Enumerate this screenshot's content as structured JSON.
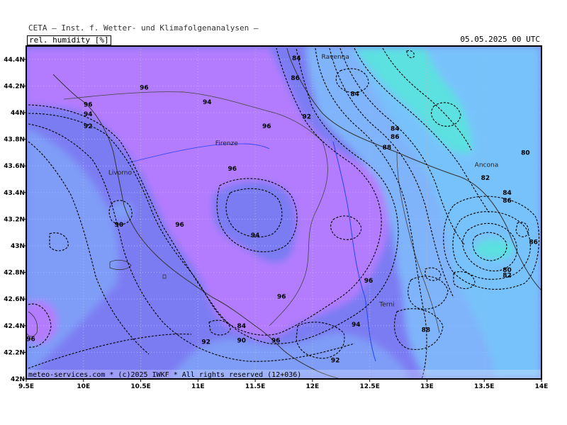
{
  "header": {
    "title": "CETA — Inst. f. Wetter- und Klimafolgenanalysen —",
    "field": "rel. humidity [%]",
    "datetime": "05.05.2025 00 UTC"
  },
  "footer": "meteo-services.com * (c)2025 IWKF * All rights reserved (12+036)",
  "axes": {
    "x_ticks": [
      "9.5E",
      "10E",
      "10.5E",
      "11E",
      "11.5E",
      "12E",
      "12.5E",
      "13E",
      "13.5E",
      "14E"
    ],
    "y_ticks": [
      "44.4N",
      "44.2N",
      "44N",
      "43.8N",
      "43.6N",
      "43.4N",
      "43.2N",
      "43N",
      "42.8N",
      "42.6N",
      "42.4N",
      "42.2N",
      "42N"
    ],
    "lon_range": [
      9.5,
      14.0
    ],
    "lat_range": [
      42.0,
      44.5
    ]
  },
  "cities": [
    {
      "name": "Ravenna",
      "lon": 12.2,
      "lat": 44.42
    },
    {
      "name": "Firenze",
      "lon": 11.25,
      "lat": 43.77
    },
    {
      "name": "Livorno",
      "lon": 10.32,
      "lat": 43.55
    },
    {
      "name": "Ancona",
      "lon": 13.52,
      "lat": 43.61
    },
    {
      "name": "Terni",
      "lon": 12.65,
      "lat": 42.56
    }
  ],
  "contour_labels": [
    {
      "text": "84",
      "lon": 11.86,
      "lat": 44.41
    },
    {
      "text": "86",
      "lon": 11.85,
      "lat": 44.26
    },
    {
      "text": "96",
      "lon": 10.53,
      "lat": 44.19
    },
    {
      "text": "84",
      "lon": 12.37,
      "lat": 44.14
    },
    {
      "text": "94",
      "lon": 11.08,
      "lat": 44.08
    },
    {
      "text": "96",
      "lon": 10.04,
      "lat": 44.06
    },
    {
      "text": "94",
      "lon": 10.04,
      "lat": 43.99
    },
    {
      "text": "92",
      "lon": 11.95,
      "lat": 43.97
    },
    {
      "text": "92",
      "lon": 10.04,
      "lat": 43.9
    },
    {
      "text": "96",
      "lon": 11.6,
      "lat": 43.9
    },
    {
      "text": "84",
      "lon": 12.72,
      "lat": 43.88
    },
    {
      "text": "86",
      "lon": 12.72,
      "lat": 43.82
    },
    {
      "text": "88",
      "lon": 12.65,
      "lat": 43.74
    },
    {
      "text": "80",
      "lon": 13.86,
      "lat": 43.7
    },
    {
      "text": "96",
      "lon": 11.3,
      "lat": 43.58
    },
    {
      "text": "82",
      "lon": 13.51,
      "lat": 43.51
    },
    {
      "text": "84",
      "lon": 13.7,
      "lat": 43.4
    },
    {
      "text": "86",
      "lon": 13.7,
      "lat": 43.34
    },
    {
      "text": "90",
      "lon": 10.31,
      "lat": 43.16
    },
    {
      "text": "96",
      "lon": 10.84,
      "lat": 43.16
    },
    {
      "text": "94",
      "lon": 11.5,
      "lat": 43.08
    },
    {
      "text": "86",
      "lon": 13.93,
      "lat": 43.03
    },
    {
      "text": "80",
      "lon": 13.7,
      "lat": 42.82
    },
    {
      "text": "82",
      "lon": 13.7,
      "lat": 42.78
    },
    {
      "text": "96",
      "lon": 12.49,
      "lat": 42.74
    },
    {
      "text": "96",
      "lon": 11.73,
      "lat": 42.62
    },
    {
      "text": "94",
      "lon": 12.38,
      "lat": 42.41
    },
    {
      "text": "84",
      "lon": 11.38,
      "lat": 42.4
    },
    {
      "text": "88",
      "lon": 12.99,
      "lat": 42.37
    },
    {
      "text": "96",
      "lon": 9.54,
      "lat": 42.3
    },
    {
      "text": "92",
      "lon": 11.07,
      "lat": 42.28
    },
    {
      "text": "90",
      "lon": 11.38,
      "lat": 42.29
    },
    {
      "text": "96",
      "lon": 11.68,
      "lat": 42.29
    },
    {
      "text": "92",
      "lon": 12.2,
      "lat": 42.14
    }
  ],
  "colors": {
    "frame_background": "#ffffff",
    "humidity_above_96": "#b37bff",
    "humidity_92_96": "#7c7cf2",
    "humidity_88_92": "#7f9cf7",
    "humidity_84_88": "#7fb4fa",
    "humidity_80_84": "#5ce0e0",
    "contour_line": "#000000",
    "coastline": "#333333",
    "river": "#2244ff",
    "grid": "#b8b8b8"
  }
}
